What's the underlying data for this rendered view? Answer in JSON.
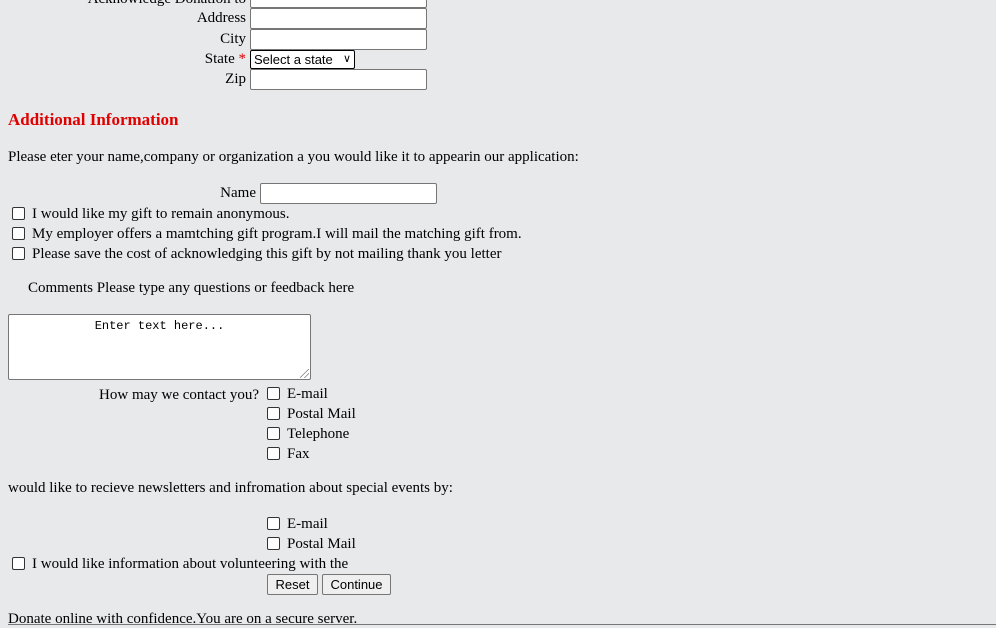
{
  "top_section": {
    "acknowledge_label": "Acknowledge Donation to",
    "address_label": "Address",
    "city_label": "City",
    "state_label": "State",
    "required_marker": "*",
    "state_select_value": "Select a state",
    "zip_label": "Zip"
  },
  "additional_info": {
    "heading": "Additional Information",
    "instruction": "Please eter your name,company or organization a you would like it to appearin our application:",
    "name_label": "Name",
    "options": [
      "I would like my gift to remain anonymous.",
      "My employer offers a mamtching gift program.I will mail the matching gift from.",
      "Please save the cost of acknowledging this gift by not mailing thank you letter"
    ],
    "comments_label": "Comments Please type any questions or feedback here",
    "comments_placeholder": "Enter text here..."
  },
  "contact": {
    "label": "How may we contact you?",
    "options": [
      "E-mail",
      "Postal Mail",
      "Telephone",
      "Fax"
    ]
  },
  "newsletter": {
    "label": "would like to recieve newsletters and infromation about special events by:",
    "options": [
      "E-mail",
      "Postal Mail"
    ],
    "volunteer_label": "I would like information about volunteering with the"
  },
  "buttons": {
    "reset": "Reset",
    "continue": "Continue"
  },
  "footer": {
    "secure_text": "Donate online with confidence.You are on a secure server."
  },
  "colors": {
    "background": "#e8e9eb",
    "accent_red": "#e00000"
  }
}
